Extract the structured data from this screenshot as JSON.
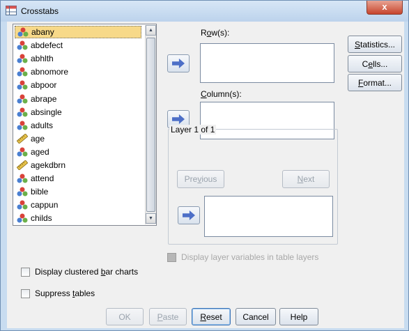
{
  "window": {
    "title": "Crosstabs",
    "close_glyph": "x"
  },
  "variable_list": {
    "items": [
      {
        "label": "abany",
        "icon": "nominal-variable-icon",
        "selected": true
      },
      {
        "label": "abdefect",
        "icon": "nominal-variable-icon"
      },
      {
        "label": "abhlth",
        "icon": "nominal-variable-icon"
      },
      {
        "label": "abnomore",
        "icon": "nominal-variable-icon"
      },
      {
        "label": "abpoor",
        "icon": "nominal-variable-icon"
      },
      {
        "label": "abrape",
        "icon": "nominal-variable-icon"
      },
      {
        "label": "absingle",
        "icon": "nominal-variable-icon"
      },
      {
        "label": "adults",
        "icon": "nominal-variable-icon"
      },
      {
        "label": "age",
        "icon": "scale-variable-icon"
      },
      {
        "label": "aged",
        "icon": "nominal-variable-icon"
      },
      {
        "label": "agekdbrn",
        "icon": "scale-variable-icon"
      },
      {
        "label": "attend",
        "icon": "nominal-variable-icon"
      },
      {
        "label": "bible",
        "icon": "nominal-variable-icon"
      },
      {
        "label": "cappun",
        "icon": "nominal-variable-icon"
      },
      {
        "label": "childs",
        "icon": "nominal-variable-icon"
      }
    ]
  },
  "rows": {
    "label_pre": "R",
    "label_ul": "o",
    "label_post": "w(s):"
  },
  "columns": {
    "label_pre": "",
    "label_ul": "C",
    "label_post": "olumn(s):"
  },
  "layer": {
    "title": "Layer 1 of 1",
    "previous_pre": "Pre",
    "previous_ul": "v",
    "previous_post": "ious",
    "next_pre": "",
    "next_ul": "N",
    "next_post": "ext"
  },
  "side_buttons": {
    "statistics_pre": "",
    "statistics_ul": "S",
    "statistics_post": "tatistics...",
    "cells_pre": "C",
    "cells_ul": "e",
    "cells_post": "lls...",
    "format_pre": "",
    "format_ul": "F",
    "format_post": "ormat..."
  },
  "options": {
    "display_layer_vars": "Display layer variables in table layers",
    "clustered_pre": "Display clustered ",
    "clustered_ul": "b",
    "clustered_post": "ar charts",
    "suppress_pre": "Suppress ",
    "suppress_ul": "t",
    "suppress_post": "ables"
  },
  "bottom_buttons": {
    "ok": "OK",
    "paste_pre": "",
    "paste_ul": "P",
    "paste_post": "aste",
    "reset_pre": "",
    "reset_ul": "R",
    "reset_post": "eset",
    "cancel": "Cancel",
    "help": "Help"
  }
}
